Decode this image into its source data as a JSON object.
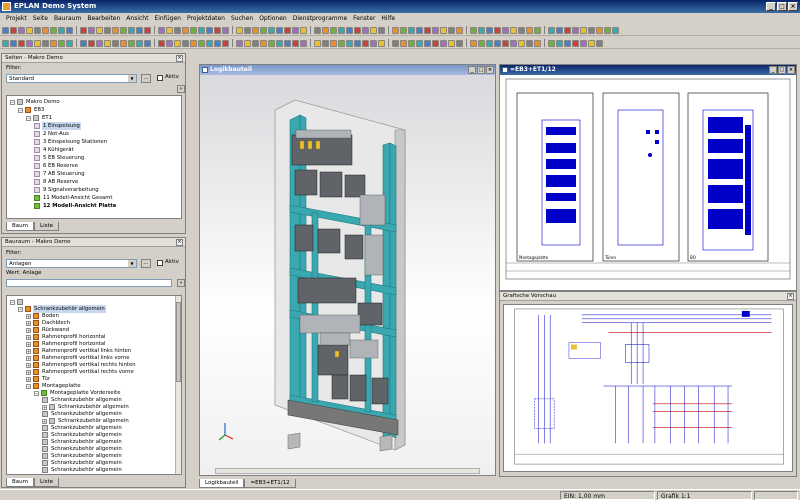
{
  "window": {
    "title": "EPLAN Demo System",
    "minimize": "_",
    "maximize": "□",
    "close": "×"
  },
  "menu": [
    "Projekt",
    "Seite",
    "Bauraum",
    "Bearbeiten",
    "Ansicht",
    "Einfügen",
    "Projektdaten",
    "Suchen",
    "Optionen",
    "Dienstprogramme",
    "Fenster",
    "Hilfe"
  ],
  "pages_panel": {
    "title": "Seiten - Makro Demo",
    "filter_label": "Filter:",
    "filter_value": "Standard",
    "filter_btn": "...",
    "active_label": "Aktiv",
    "tree": [
      {
        "label": "Makro Demo",
        "level": 0,
        "exp": "-",
        "icon": "gr"
      },
      {
        "label": "EB3",
        "level": 1,
        "exp": "-",
        "icon": "o"
      },
      {
        "label": "ET1",
        "level": 2,
        "exp": "-",
        "icon": "gr"
      },
      {
        "label": "1 Einspeisung",
        "level": 3,
        "icon": "",
        "sel": true
      },
      {
        "label": "2 Not-Aus",
        "level": 3,
        "icon": ""
      },
      {
        "label": "3 Einspeisung Stationen",
        "level": 3,
        "icon": ""
      },
      {
        "label": "4 Kühlgerät",
        "level": 3,
        "icon": ""
      },
      {
        "label": "5 EB Steuerung",
        "level": 3,
        "icon": ""
      },
      {
        "label": "6 EB Reserve",
        "level": 3,
        "icon": ""
      },
      {
        "label": "7 AB Steuerung",
        "level": 3,
        "icon": ""
      },
      {
        "label": "8 AB Reserve",
        "level": 3,
        "icon": ""
      },
      {
        "label": "9 Signalverarbeitung",
        "level": 3,
        "icon": ""
      },
      {
        "label": "11 Modell-Ansicht Gesamt",
        "level": 3,
        "icon": "g"
      },
      {
        "label": "12 Modell-Ansicht Platte",
        "level": 3,
        "icon": "g",
        "bold": true
      }
    ],
    "tabs": [
      "Baum",
      "Liste"
    ]
  },
  "layout_panel": {
    "title": "Bauraum - Makro Demo",
    "filter_label": "Filter:",
    "filter_value": "Anlagen",
    "filter_btn": "...",
    "active_label": "Aktiv",
    "value_label": "Wert: Anlage",
    "tree": [
      {
        "label": "",
        "level": 0,
        "exp": "-",
        "icon": "gr"
      },
      {
        "label": "Schrankzubehör allgemein",
        "level": 1,
        "exp": "-",
        "icon": "o",
        "sel": true
      },
      {
        "label": "Boden",
        "level": 2,
        "exp": "+",
        "icon": "o"
      },
      {
        "label": "Dachblech",
        "level": 2,
        "exp": "+",
        "icon": "o"
      },
      {
        "label": "Rückwand",
        "level": 2,
        "exp": "+",
        "icon": "o"
      },
      {
        "label": "Rahmenprofil horizontal",
        "level": 2,
        "exp": "+",
        "icon": "o"
      },
      {
        "label": "Rahmenprofil horizontal",
        "level": 2,
        "exp": "+",
        "icon": "o"
      },
      {
        "label": "Rahmenprofil vertikal links hinten",
        "level": 2,
        "exp": "+",
        "icon": "o"
      },
      {
        "label": "Rahmenprofil vertikal links vorne",
        "level": 2,
        "exp": "+",
        "icon": "o"
      },
      {
        "label": "Rahmenprofil vertikal rechts hinten",
        "level": 2,
        "exp": "+",
        "icon": "o"
      },
      {
        "label": "Rahmenprofil vertikal rechts vorne",
        "level": 2,
        "exp": "+",
        "icon": "o"
      },
      {
        "label": "Tür",
        "level": 2,
        "exp": "+",
        "icon": "o"
      },
      {
        "label": "Montageplatte",
        "level": 2,
        "exp": "-",
        "icon": "o"
      },
      {
        "label": "Montageplatte Vorderseite",
        "level": 3,
        "exp": "-",
        "icon": "g"
      },
      {
        "label": "Schrankzubehör allgemein",
        "level": 4,
        "icon": "gr"
      },
      {
        "label": "Schrankzubehör allgemein",
        "level": 4,
        "exp": "+",
        "icon": "gr"
      },
      {
        "label": "Schrankzubehör allgemein",
        "level": 4,
        "icon": "gr"
      },
      {
        "label": "Schrankzubehör allgemein",
        "level": 4,
        "exp": "+",
        "icon": "gr"
      },
      {
        "label": "Schrankzubehör allgemein",
        "level": 4,
        "icon": "gr"
      },
      {
        "label": "Schrankzubehör allgemein",
        "level": 4,
        "icon": "gr"
      },
      {
        "label": "Schrankzubehör allgemein",
        "level": 4,
        "icon": "gr"
      },
      {
        "label": "Schrankzubehör allgemein",
        "level": 4,
        "icon": "gr"
      },
      {
        "label": "Schrankzubehör allgemein",
        "level": 4,
        "icon": "gr"
      },
      {
        "label": "Schrankzubehör allgemein",
        "level": 4,
        "icon": "gr"
      },
      {
        "label": "Schrankzubehör allgemein",
        "level": 4,
        "icon": "gr"
      }
    ],
    "tabs": [
      "Baum",
      "Liste"
    ]
  },
  "view_3d": {
    "title": "Logikbauteil"
  },
  "view_sheet": {
    "title": "=EB3+ET1/12",
    "captions": [
      "Montageplatte",
      "Türen",
      "BO"
    ]
  },
  "view_preview": {
    "title": "Grafische Vorschau"
  },
  "doc_tabs": [
    "Logikbauteil",
    "=EB3+ET1/12"
  ],
  "status": {
    "ein": "EIN: 1,00 mm",
    "grafik": "Grafik 1:1"
  },
  "colors": {
    "frame": "#3aa8b0",
    "titlebar": "#0a246a",
    "selection": "#c7d7ef"
  }
}
